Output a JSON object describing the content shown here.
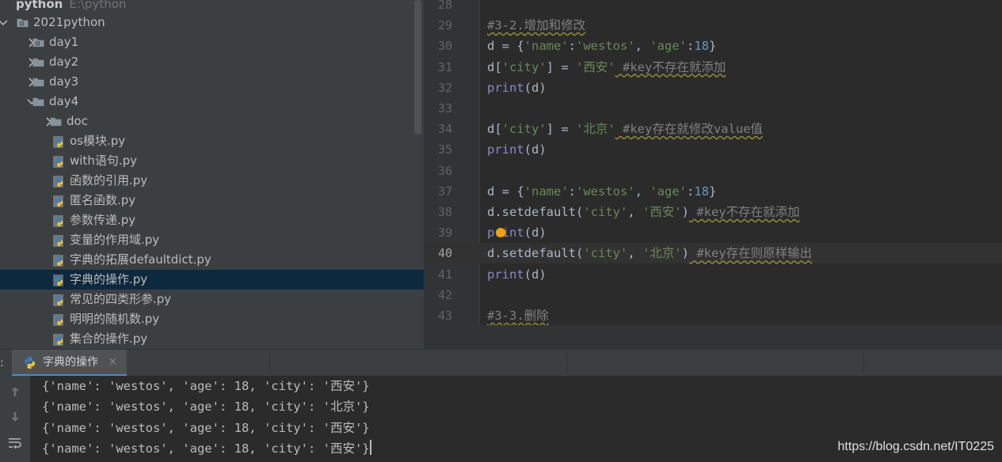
{
  "colors": {
    "accent": "#4a88c7",
    "selection": "#0d293e",
    "string": "#6a8759",
    "number": "#6897bb",
    "builtin": "#8888c6",
    "comment": "#808080"
  },
  "project": {
    "root": {
      "name": "python",
      "path": "E:\\python"
    },
    "items": [
      {
        "label": "2021python",
        "type": "folder",
        "arrow": "down",
        "indent": 0,
        "icon": "module-folder-icon"
      },
      {
        "label": "day1",
        "type": "folder",
        "arrow": "right",
        "indent": 1,
        "icon": "module-folder-icon"
      },
      {
        "label": "day2",
        "type": "folder",
        "arrow": "right",
        "indent": 1,
        "icon": "folder-icon"
      },
      {
        "label": "day3",
        "type": "folder",
        "arrow": "right",
        "indent": 1,
        "icon": "folder-icon"
      },
      {
        "label": "day4",
        "type": "folder",
        "arrow": "down",
        "indent": 1,
        "icon": "folder-icon"
      },
      {
        "label": "doc",
        "type": "folder",
        "arrow": "right",
        "indent": 2,
        "icon": "folder-icon"
      },
      {
        "label": "os模块.py",
        "type": "file",
        "indent": 2,
        "icon": "python-file-icon"
      },
      {
        "label": "with语句.py",
        "type": "file",
        "indent": 2,
        "icon": "python-file-icon"
      },
      {
        "label": "函数的引用.py",
        "type": "file",
        "indent": 2,
        "icon": "python-file-icon"
      },
      {
        "label": "匿名函数.py",
        "type": "file",
        "indent": 2,
        "icon": "python-file-icon"
      },
      {
        "label": "参数传递.py",
        "type": "file",
        "indent": 2,
        "icon": "python-file-icon"
      },
      {
        "label": "变量的作用域.py",
        "type": "file",
        "indent": 2,
        "icon": "python-file-icon"
      },
      {
        "label": "字典的拓展defaultdict.py",
        "type": "file",
        "indent": 2,
        "icon": "python-file-icon"
      },
      {
        "label": "字典的操作.py",
        "type": "file",
        "indent": 2,
        "icon": "python-file-icon",
        "selected": true
      },
      {
        "label": "常见的四类形参.py",
        "type": "file",
        "indent": 2,
        "icon": "python-file-icon"
      },
      {
        "label": "明明的随机数.py",
        "type": "file",
        "indent": 2,
        "icon": "python-file-icon"
      },
      {
        "label": "集合的操作.py",
        "type": "file",
        "indent": 2,
        "icon": "python-file-icon"
      }
    ]
  },
  "editor": {
    "current_line": "40",
    "lines": [
      {
        "n": "28",
        "tokens": []
      },
      {
        "n": "29",
        "tokens": [
          {
            "t": "#3-2.增加和修改",
            "c": "comment"
          }
        ]
      },
      {
        "n": "30",
        "tokens": [
          {
            "t": "d = {",
            "c": "plain"
          },
          {
            "t": "'name'",
            "c": "string"
          },
          {
            "t": ":",
            "c": "plain"
          },
          {
            "t": "'westos'",
            "c": "string"
          },
          {
            "t": ", ",
            "c": "plain"
          },
          {
            "t": "'age'",
            "c": "string"
          },
          {
            "t": ":",
            "c": "plain"
          },
          {
            "t": "18",
            "c": "number"
          },
          {
            "t": "}",
            "c": "plain"
          }
        ]
      },
      {
        "n": "31",
        "tokens": [
          {
            "t": "d[",
            "c": "plain"
          },
          {
            "t": "'city'",
            "c": "string"
          },
          {
            "t": "] = ",
            "c": "plain"
          },
          {
            "t": "'西安'",
            "c": "string"
          },
          {
            "t": " #key不存在就添加",
            "c": "comment"
          }
        ]
      },
      {
        "n": "32",
        "tokens": [
          {
            "t": "print",
            "c": "builtin"
          },
          {
            "t": "(d)",
            "c": "plain"
          }
        ]
      },
      {
        "n": "33",
        "tokens": []
      },
      {
        "n": "34",
        "tokens": [
          {
            "t": "d[",
            "c": "plain"
          },
          {
            "t": "'city'",
            "c": "string"
          },
          {
            "t": "] = ",
            "c": "plain"
          },
          {
            "t": "'北京'",
            "c": "string"
          },
          {
            "t": " #key存在就修改value值",
            "c": "comment"
          }
        ]
      },
      {
        "n": "35",
        "tokens": [
          {
            "t": "print",
            "c": "builtin"
          },
          {
            "t": "(d)",
            "c": "plain"
          }
        ]
      },
      {
        "n": "36",
        "tokens": []
      },
      {
        "n": "37",
        "tokens": [
          {
            "t": "d = {",
            "c": "plain"
          },
          {
            "t": "'name'",
            "c": "string"
          },
          {
            "t": ":",
            "c": "plain"
          },
          {
            "t": "'westos'",
            "c": "string"
          },
          {
            "t": ", ",
            "c": "plain"
          },
          {
            "t": "'age'",
            "c": "string"
          },
          {
            "t": ":",
            "c": "plain"
          },
          {
            "t": "18",
            "c": "number"
          },
          {
            "t": "}",
            "c": "plain"
          }
        ]
      },
      {
        "n": "38",
        "tokens": [
          {
            "t": "d.setdefault(",
            "c": "plain"
          },
          {
            "t": "'city'",
            "c": "string"
          },
          {
            "t": ", ",
            "c": "plain"
          },
          {
            "t": "'西安'",
            "c": "string"
          },
          {
            "t": ")",
            "c": "plain"
          },
          {
            "t": " #key不存在就添加",
            "c": "comment"
          }
        ]
      },
      {
        "n": "39",
        "tokens": [
          {
            "t": "print",
            "c": "builtin"
          },
          {
            "t": "(d)",
            "c": "plain"
          }
        ]
      },
      {
        "n": "40",
        "tokens": [
          {
            "t": "d.setdefault(",
            "c": "plain"
          },
          {
            "t": "'city'",
            "c": "string"
          },
          {
            "t": ", ",
            "c": "plain"
          },
          {
            "t": "'北京'",
            "c": "string"
          },
          {
            "t": ")",
            "c": "plain"
          },
          {
            "t": " #key存在则原样输出",
            "c": "comment"
          }
        ]
      },
      {
        "n": "41",
        "tokens": [
          {
            "t": "print",
            "c": "builtin"
          },
          {
            "t": "(d)",
            "c": "plain"
          }
        ]
      },
      {
        "n": "42",
        "tokens": []
      },
      {
        "n": "43",
        "tokens": [
          {
            "t": "#3-3.删除",
            "c": "comment"
          }
        ]
      }
    ]
  },
  "run": {
    "prefix": ":",
    "tab_label": "字典的操作",
    "close_symbol": "×",
    "toolbar": [
      {
        "name": "scroll-up-icon"
      },
      {
        "name": "scroll-down-icon"
      },
      {
        "name": "soft-wrap-icon"
      }
    ],
    "output": [
      "{'name': 'westos', 'age': 18, 'city': '西安'}",
      "{'name': 'westos', 'age': 18, 'city': '北京'}",
      "{'name': 'westos', 'age': 18, 'city': '西安'}",
      "{'name': 'westos', 'age': 18, 'city': '西安'}"
    ]
  },
  "watermark": "https://blog.csdn.net/IT0225"
}
